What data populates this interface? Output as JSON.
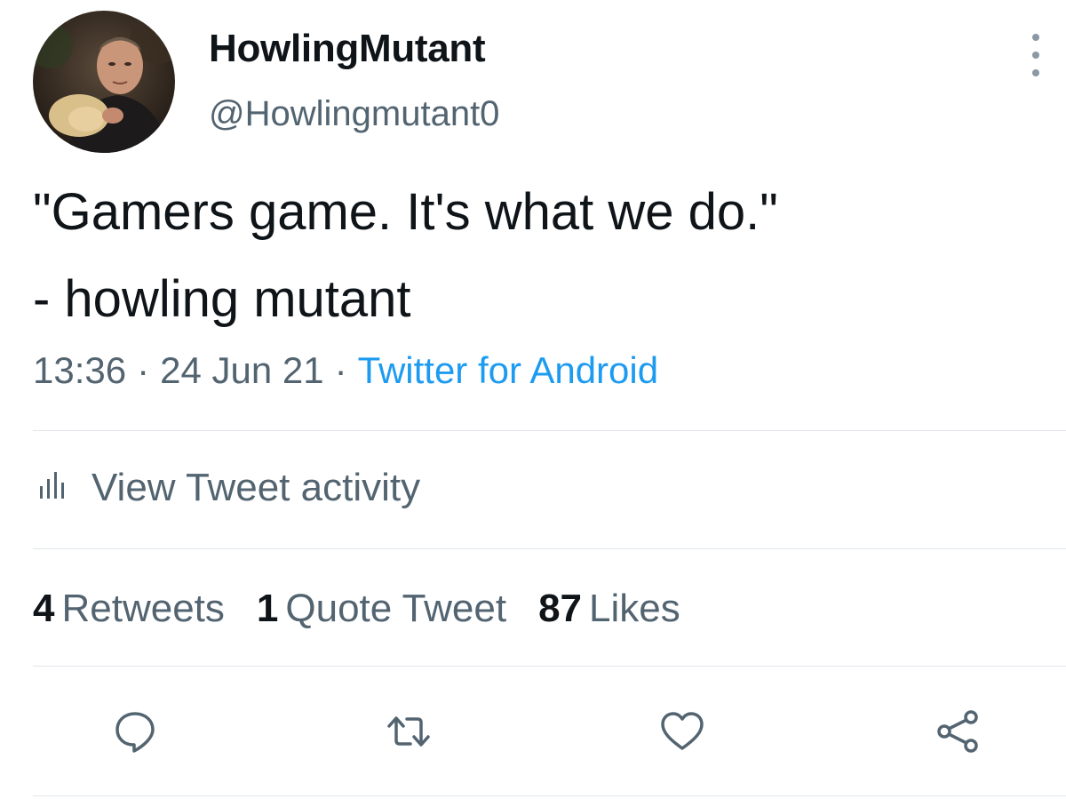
{
  "author": {
    "display_name": "HowlingMutant",
    "handle": "@Howlingmutant0"
  },
  "tweet": {
    "text": "\"Gamers game.  It's what we do.\"\n- howling mutant",
    "time": "13:36",
    "separator": "·",
    "date": "24 Jun 21",
    "source": "Twitter for Android"
  },
  "activity": {
    "label": "View Tweet activity"
  },
  "stats": {
    "retweets_count": "4",
    "retweets_label": "Retweets",
    "quotes_count": "1",
    "quotes_label": "Quote Tweet",
    "likes_count": "87",
    "likes_label": "Likes"
  },
  "colors": {
    "link": "#1d9bf0",
    "secondary_text": "#536471",
    "primary_text": "#0f1419",
    "divider": "#e1e6ea"
  },
  "icons": {
    "more": "more-vertical-icon",
    "activity": "bar-chart-icon",
    "reply": "reply-icon",
    "retweet": "retweet-icon",
    "like": "heart-icon",
    "share": "share-icon"
  }
}
